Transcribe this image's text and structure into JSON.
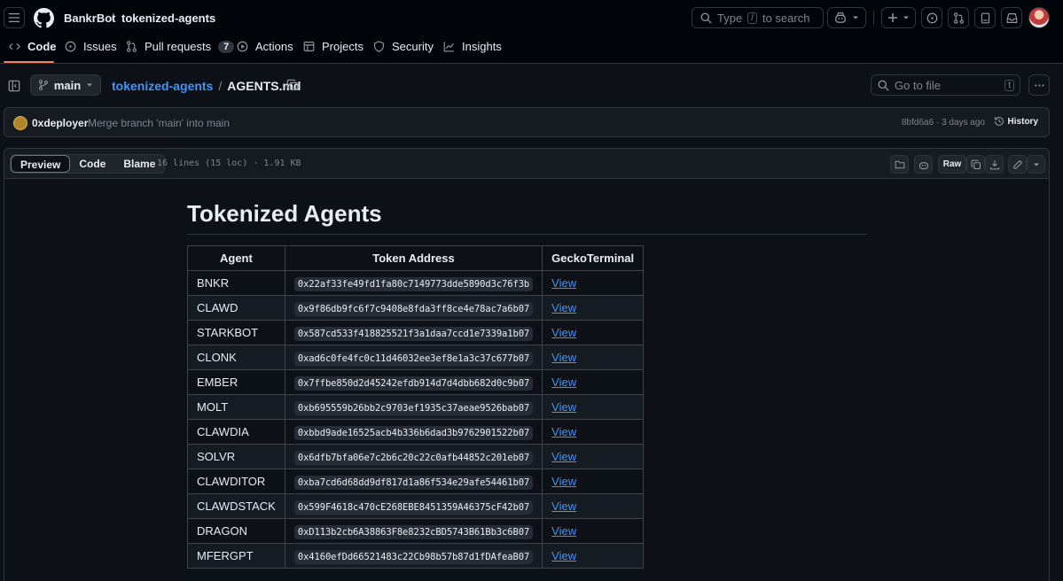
{
  "header": {
    "owner": "BankrBot",
    "separator": "/",
    "repo": "tokenized-agents",
    "search_type": "Type",
    "search_key": "/",
    "search_rest": "to search"
  },
  "tabs": [
    {
      "label": "Code",
      "icon": "code-icon"
    },
    {
      "label": "Issues",
      "icon": "issue-icon"
    },
    {
      "label": "Pull requests",
      "icon": "pull-request-icon",
      "count": "7"
    },
    {
      "label": "Actions",
      "icon": "play-icon"
    },
    {
      "label": "Projects",
      "icon": "table-icon"
    },
    {
      "label": "Security",
      "icon": "shield-icon"
    },
    {
      "label": "Insights",
      "icon": "graph-icon"
    }
  ],
  "filenav": {
    "branch": "main",
    "repo_link": "tokenized-agents",
    "separator": "/",
    "file": "AGENTS.md",
    "goto_placeholder": "Go to file",
    "goto_key": "t"
  },
  "commit": {
    "author": "0xdeployer",
    "message": "Merge branch 'main' into main",
    "hash": "8bfd6a6",
    "dot": "·",
    "when": "3 days ago",
    "history_label": "History"
  },
  "file_toolbar": {
    "views": [
      "Preview",
      "Code",
      "Blame"
    ],
    "active_view": "Preview",
    "info": "16 lines (15 loc) · 1.91 KB",
    "raw_label": "Raw"
  },
  "document": {
    "title": "Tokenized Agents",
    "table": {
      "headers": [
        "Agent",
        "Token Address",
        "GeckoTerminal"
      ],
      "rows": [
        {
          "agent": "BNKR",
          "address": "0x22af33fe49fd1fa80c7149773dde5890d3c76f3b",
          "link": "View"
        },
        {
          "agent": "CLAWD",
          "address": "0x9f86db9fc6f7c9408e8fda3ff8ce4e78ac7a6b07",
          "link": "View"
        },
        {
          "agent": "STARKBOT",
          "address": "0x587cd533f418825521f3a1daa7ccd1e7339a1b07",
          "link": "View"
        },
        {
          "agent": "CLONK",
          "address": "0xad6c0fe4fc0c11d46032ee3ef8e1a3c37c677b07",
          "link": "View"
        },
        {
          "agent": "EMBER",
          "address": "0x7ffbe850d2d45242efdb914d7d4dbb682d0c9b07",
          "link": "View"
        },
        {
          "agent": "MOLT",
          "address": "0xb695559b26bb2c9703ef1935c37aeae9526bab07",
          "link": "View"
        },
        {
          "agent": "CLAWDIA",
          "address": "0xbbd9ade16525acb4b336b6dad3b9762901522b07",
          "link": "View"
        },
        {
          "agent": "SOLVR",
          "address": "0x6dfb7bfa06e7c2b6c20c22c0afb44852c201eb07",
          "link": "View"
        },
        {
          "agent": "CLAWDITOR",
          "address": "0xba7cd6d68dd9df817d1a86f534e29afe54461b07",
          "link": "View"
        },
        {
          "agent": "CLAWDSTACK",
          "address": "0x599F4618c470cE268EBE8451359A46375cF42b07",
          "link": "View"
        },
        {
          "agent": "DRAGON",
          "address": "0xD113b2cb6A38863F8e8232cBD5743B61Bb3c6B07",
          "link": "View"
        },
        {
          "agent": "MFERGPT",
          "address": "0x4160efDd66521483c22Cb98b57b87d1fDAfeaB07",
          "link": "View"
        }
      ]
    }
  },
  "colors": {
    "background": "#0d1117",
    "header_bg": "#010409",
    "border": "#30363d",
    "link": "#4493f8",
    "active_tab_underline": "#f78166",
    "muted_text": "#7d8590"
  }
}
